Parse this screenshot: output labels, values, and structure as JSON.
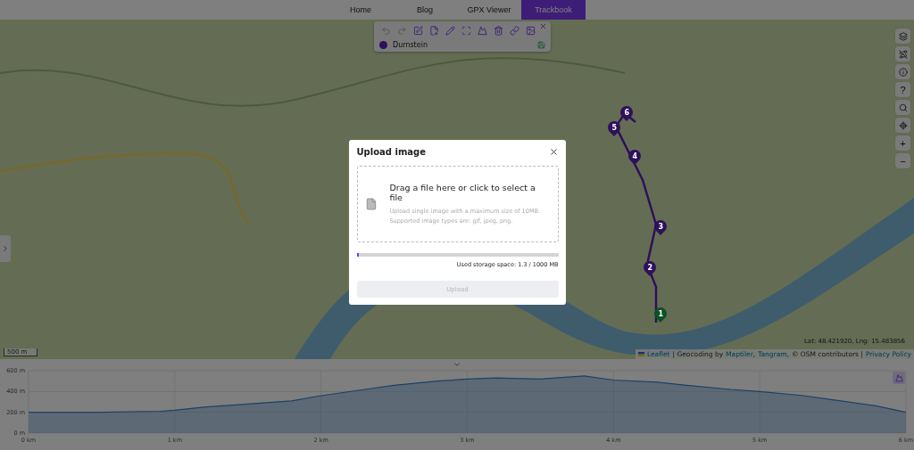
{
  "nav": {
    "items": [
      {
        "label": "Home",
        "selected": false
      },
      {
        "label": "Blog",
        "selected": false
      },
      {
        "label": "GPX Viewer",
        "selected": false
      },
      {
        "label": "Trackbook",
        "selected": true
      }
    ]
  },
  "toolbar": {
    "tools": [
      {
        "kind": "undo",
        "disabled": true
      },
      {
        "kind": "redo",
        "disabled": true
      },
      {
        "kind": "edit",
        "disabled": false
      },
      {
        "kind": "file",
        "disabled": false
      },
      {
        "kind": "pen",
        "disabled": false
      },
      {
        "kind": "fit",
        "disabled": false
      },
      {
        "kind": "mountain",
        "disabled": false
      },
      {
        "kind": "trash",
        "disabled": false
      },
      {
        "kind": "link",
        "disabled": false
      },
      {
        "kind": "image",
        "disabled": false
      }
    ],
    "track": {
      "name": "Durnstein",
      "color": "#2d115b"
    }
  },
  "map": {
    "markers": [
      {
        "label": "1",
        "color": "#0b5225"
      },
      {
        "label": "2",
        "color": "#2d115b"
      },
      {
        "label": "3",
        "color": "#2d115b"
      },
      {
        "label": "4",
        "color": "#2d115b"
      },
      {
        "label": "5",
        "color": "#2d115b"
      },
      {
        "label": "6",
        "color": "#2d115b"
      }
    ],
    "controls": [
      {
        "kind": "layers"
      },
      {
        "kind": "route-off"
      },
      {
        "kind": "info"
      },
      {
        "kind": "text",
        "label": "?"
      },
      {
        "kind": "search"
      },
      {
        "kind": "locate"
      },
      {
        "kind": "text",
        "label": "+"
      },
      {
        "kind": "text",
        "label": "−"
      }
    ],
    "scale": "500 m",
    "coordinates": "Lat: 48.421920, Lng: 15.483856",
    "attribution": [
      {
        "kind": "link",
        "text": "Leaflet"
      },
      {
        "kind": "text",
        "text": "| Geocoding by"
      },
      {
        "kind": "link",
        "text": "Maptiler,"
      },
      {
        "kind": "link",
        "text": "Tangram,"
      },
      {
        "kind": "text",
        "text": "© OSM contributors |"
      },
      {
        "kind": "link",
        "text": "Privacy Policy"
      }
    ]
  },
  "modal": {
    "title": "Upload image",
    "heading": "Drag a file here or click to select a file",
    "lines": [
      "Upload single image with a maximum size of 10MB.",
      "Supported image types are: gif, jpeg, png."
    ],
    "storage": {
      "level": 0.0013,
      "label": "Used storage space: 1.3 / 1000 MB"
    },
    "upload": {
      "label": "Upload",
      "disabled": true
    }
  },
  "elevation": {
    "chart_data": {
      "type": "area",
      "x": [
        0,
        0.5,
        0.9,
        1.0,
        1.2,
        1.5,
        1.8,
        2.0,
        2.3,
        2.5,
        2.8,
        3.0,
        3.2,
        3.5,
        3.8,
        4.0,
        4.3,
        4.5,
        4.8,
        5.0,
        5.3,
        5.5,
        5.8,
        6.0
      ],
      "series": [
        {
          "color": "#3b82c4",
          "values": [
            200,
            200,
            210,
            220,
            250,
            280,
            310,
            360,
            420,
            460,
            500,
            520,
            530,
            520,
            550,
            510,
            490,
            460,
            420,
            400,
            360,
            320,
            260,
            200
          ]
        }
      ],
      "grid": true,
      "xlim": [
        0,
        6
      ],
      "ylim": [
        0,
        600
      ],
      "xticks": [
        {
          "value": 0,
          "label": "0 km"
        },
        {
          "value": 1,
          "label": "1 km"
        },
        {
          "value": 2,
          "label": "2 km"
        },
        {
          "value": 3,
          "label": "3 km"
        },
        {
          "value": 4,
          "label": "4 km"
        },
        {
          "value": 5,
          "label": "5 km"
        },
        {
          "value": 6,
          "label": "6 km"
        }
      ],
      "yticks": [
        {
          "value": 0,
          "label": "0 m"
        },
        {
          "value": 200,
          "label": "200 m"
        },
        {
          "value": 400,
          "label": "400 m"
        },
        {
          "value": 600,
          "label": "600 m"
        }
      ]
    }
  }
}
